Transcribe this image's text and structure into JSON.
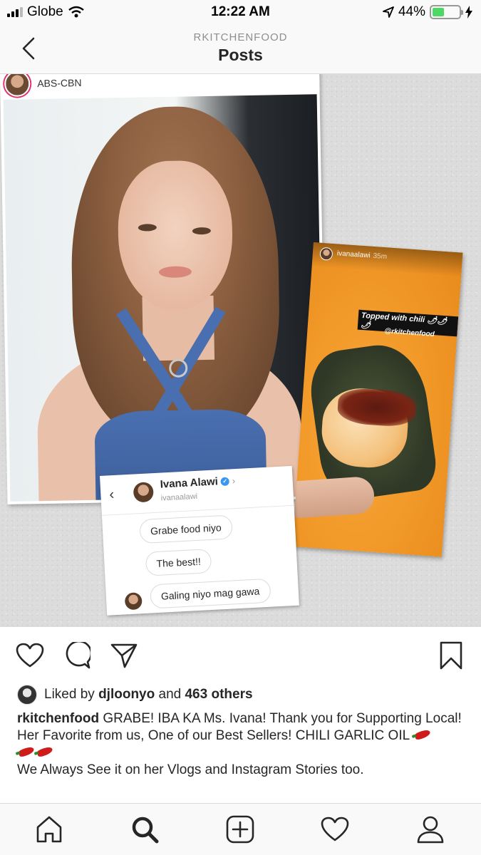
{
  "status_bar": {
    "carrier": "Globe",
    "time": "12:22 AM",
    "battery_percent": "44%",
    "battery_level": 0.44,
    "icons": [
      "signal-icon",
      "wifi-icon",
      "location-icon",
      "battery-icon",
      "charging-icon"
    ]
  },
  "header": {
    "username": "RKITCHENFOOD",
    "title": "Posts",
    "back_icon": "chevron-left-icon"
  },
  "post_image": {
    "photo_card": {
      "account_name": "ABS-CBN"
    },
    "dm": {
      "contact_name": "Ivana Alawi",
      "contact_handle": "ivanaalawi",
      "messages": [
        "Grabe food niyo",
        "The best!!",
        "Galing niyo mag gawa"
      ]
    },
    "story": {
      "username": "ivanaalawi",
      "time": "35m",
      "tag_text": "Topped with chili 🌶🌶🌶",
      "mention": "@rkitchenfood"
    }
  },
  "actions": {
    "icons": [
      "heart-icon",
      "comment-icon",
      "share-icon",
      "bookmark-icon"
    ]
  },
  "likes": {
    "prefix": "Liked by",
    "liker": "djloonyo",
    "connector": "and",
    "others": "463 others"
  },
  "caption": {
    "username": "rkitchenfood",
    "line1": "GRABE! IBA KA Ms. Ivana! Thank you for Supporting Local!",
    "line2": "Her Favorite from us, One of our Best Sellers! CHILI GARLIC OIL",
    "line3": "We Always See it on her Vlogs and Instagram Stories too."
  },
  "tab_bar": {
    "icons": [
      "home-icon",
      "search-icon",
      "new-post-icon",
      "activity-heart-icon",
      "profile-icon"
    ],
    "active": "search-icon"
  }
}
